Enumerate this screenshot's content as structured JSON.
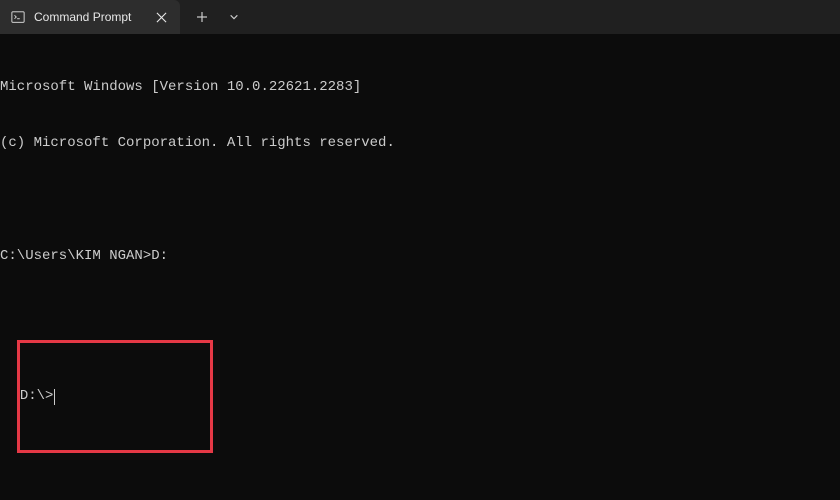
{
  "tab": {
    "title": "Command Prompt"
  },
  "terminal": {
    "line1": "Microsoft Windows [Version 10.0.22621.2283]",
    "line2": "(c) Microsoft Corporation. All rights reserved.",
    "prompt1": "C:\\Users\\KIM NGAN>",
    "command1": "D:",
    "prompt2": "D:\\>"
  }
}
